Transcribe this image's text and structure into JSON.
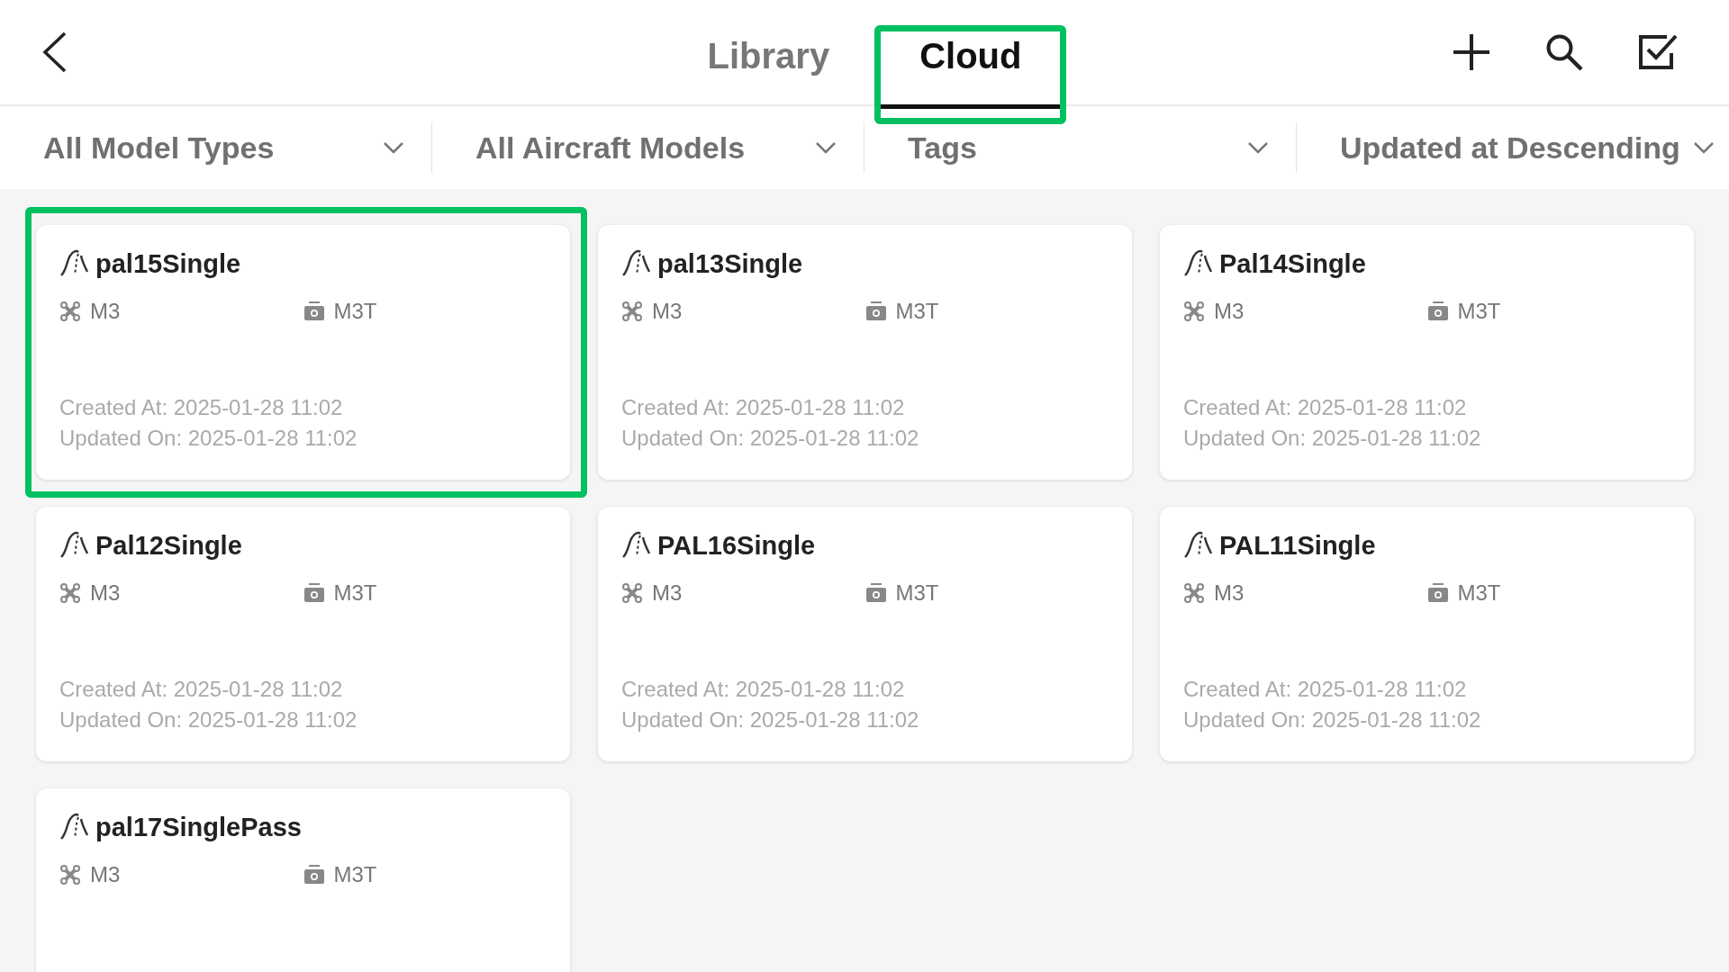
{
  "tabs": [
    {
      "label": "Library",
      "selected": false,
      "highlighted": false
    },
    {
      "label": "Cloud",
      "selected": true,
      "highlighted": true
    }
  ],
  "filters": [
    {
      "label": "All Model Types"
    },
    {
      "label": "All Aircraft Models"
    },
    {
      "label": "Tags"
    },
    {
      "label": "Updated at Descending"
    }
  ],
  "routes": [
    {
      "name": "pal15Single",
      "aircraft": "M3",
      "payload": "M3T",
      "created": "Created At: 2025-01-28 11:02",
      "updated": "Updated On: 2025-01-28 11:02",
      "highlighted": true
    },
    {
      "name": "pal13Single",
      "aircraft": "M3",
      "payload": "M3T",
      "created": "Created At: 2025-01-28 11:02",
      "updated": "Updated On: 2025-01-28 11:02",
      "highlighted": false
    },
    {
      "name": "Pal14Single",
      "aircraft": "M3",
      "payload": "M3T",
      "created": "Created At: 2025-01-28 11:02",
      "updated": "Updated On: 2025-01-28 11:02",
      "highlighted": false
    },
    {
      "name": "Pal12Single",
      "aircraft": "M3",
      "payload": "M3T",
      "created": "Created At: 2025-01-28 11:02",
      "updated": "Updated On: 2025-01-28 11:02",
      "highlighted": false
    },
    {
      "name": "PAL16Single",
      "aircraft": "M3",
      "payload": "M3T",
      "created": "Created At: 2025-01-28 11:02",
      "updated": "Updated On: 2025-01-28 11:02",
      "highlighted": false
    },
    {
      "name": "PAL11Single",
      "aircraft": "M3",
      "payload": "M3T",
      "created": "Created At: 2025-01-28 11:02",
      "updated": "Updated On: 2025-01-28 11:02",
      "highlighted": false
    },
    {
      "name": "pal17SinglePass",
      "aircraft": "M3",
      "payload": "M3T",
      "highlighted": false
    }
  ]
}
